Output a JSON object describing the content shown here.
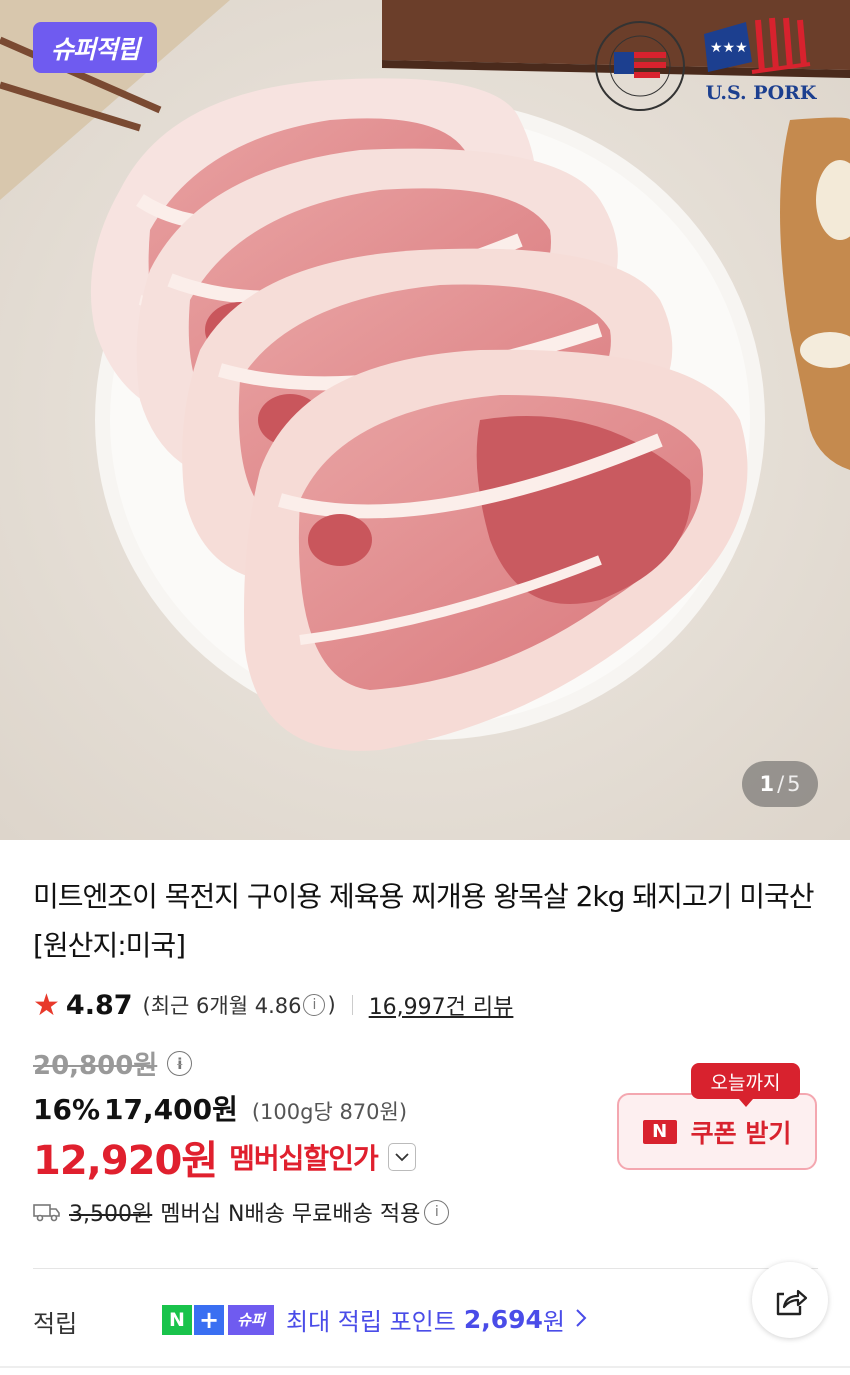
{
  "hero": {
    "badge": "슈퍼적립",
    "brand_logo_1": "U.S.MEAT EXPORT FEDERATION",
    "brand_logo_2": "U.S. PORK",
    "counter_current": "1",
    "counter_sep": "/",
    "counter_total": "5"
  },
  "product": {
    "title": "미트엔조이 목전지 구이용 제육용 찌개용 왕목살 2kg 돼지고기 미국산 [원산지:미국]",
    "rating": "4.87",
    "recent_prefix": "(최근 6개월 4.86",
    "recent_suffix": ")",
    "reviews": "16,997건 리뷰"
  },
  "price": {
    "original": "20,800원",
    "discount_pct": "16%",
    "sale": "17,400원",
    "unit_price": "(100g당 870원)",
    "member_price": "12,920원",
    "member_label": "멤버십할인가"
  },
  "coupon": {
    "tag": "오늘까지",
    "n_mark": "N",
    "label": "쿠폰 받기"
  },
  "shipping": {
    "fee": "3,500원",
    "text": "멤버십 N배송 무료배송 적용"
  },
  "earn": {
    "label": "적립",
    "badge_n": "N",
    "badge_plus": "+",
    "badge_super": "슈퍼",
    "text": "최대 적립 포인트",
    "points": "2,694",
    "unit": "원"
  },
  "icons": {
    "star": "star-icon",
    "info": "info-icon",
    "chevron": "chevron-down-icon",
    "truck": "truck-icon",
    "share": "share-icon"
  },
  "colors": {
    "brand_purple": "#6f5bf0",
    "sale_red": "#e0202e",
    "coupon_red": "#d8222e",
    "naver_green": "#19c34b",
    "points_blue": "#4a4ce8"
  }
}
